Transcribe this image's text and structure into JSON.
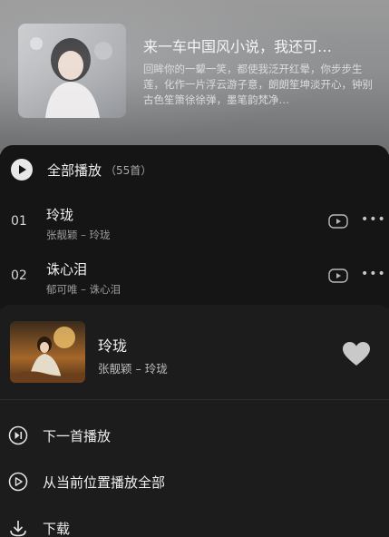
{
  "playlist": {
    "title": "来一车中国风小说，我还可…",
    "description": "回眸你的一颦一笑，都使我泛开红晕，你步步生莲，化作一片浮云游子意，朗朗笙坤淡开心，钟别古色笙箫徐徐弹，墨笔韵梵净…"
  },
  "list": {
    "play_all_label": "全部播放",
    "count_label": "（55首）",
    "tracks": [
      {
        "index": "01",
        "title": "玲珑",
        "subtitle": "张靓颖 – 玲珑"
      },
      {
        "index": "02",
        "title": "诛心泪",
        "subtitle": "郁可唯 – 诛心泪"
      }
    ]
  },
  "sheet": {
    "title": "玲珑",
    "subtitle": "张靓颖 – 玲珑",
    "actions": [
      {
        "label": "下一首播放",
        "icon": "play-next-icon"
      },
      {
        "label": "从当前位置播放全部",
        "icon": "play-circle-icon"
      },
      {
        "label": "下载",
        "icon": "download-icon"
      }
    ]
  },
  "colors": {
    "panel": "#151515",
    "sheet": "#1c1c1c",
    "text_primary": "#f2f2f2",
    "text_secondary": "#9b9b9b"
  }
}
